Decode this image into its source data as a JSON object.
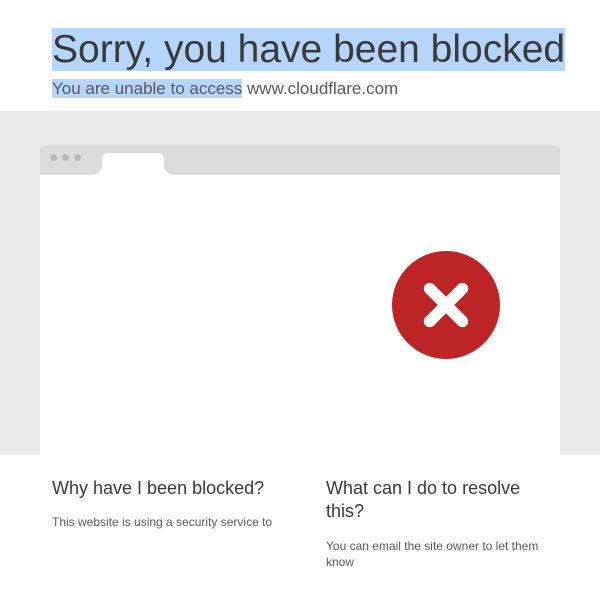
{
  "header": {
    "title": "Sorry, you have been blocked",
    "subtitle_prefix": "You are unable to access",
    "subtitle_host": " www.cloudflare.com"
  },
  "columns": {
    "left": {
      "heading": "Why have I been blocked?",
      "body": "This website is using a security service to"
    },
    "right": {
      "heading": "What can I do to resolve this?",
      "body": "You can email the site owner to let them know"
    }
  }
}
